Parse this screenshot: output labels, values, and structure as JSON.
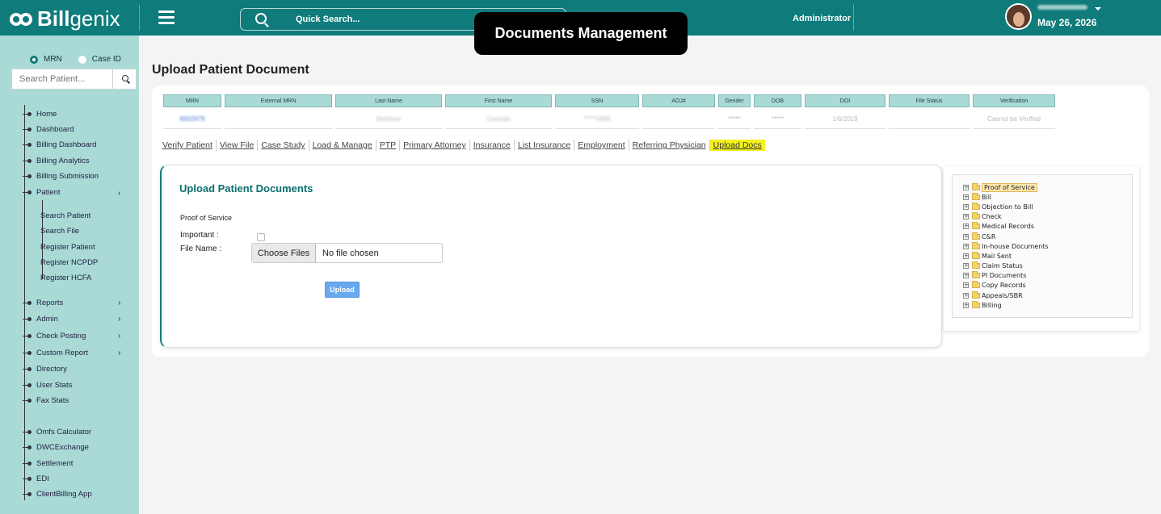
{
  "header": {
    "logo_bold": "Bill",
    "logo_light": "genix",
    "quick_search": "Quick Search...",
    "role": "Administrator",
    "date": "May 26, 2026"
  },
  "banner": "Documents Management",
  "sidebar": {
    "radio_mrn": "MRN",
    "radio_case": "Case ID",
    "search_placeholder": "Search Patient...",
    "items": [
      "Home",
      "Dashboard",
      "Billing Dashboard",
      "Billing Analytics",
      "Billing Submission",
      "Patient"
    ],
    "patient_sub": [
      "Search Patient",
      "Search File",
      "Register Patient",
      "Register NCPDP",
      "Register HCFA"
    ],
    "items2": [
      "Reports",
      "Admin",
      "Check Posting",
      "Custom Report",
      "Directory",
      "User Stats",
      "Fax Stats"
    ],
    "items3": [
      "Omfs Calculator",
      "DWCExchange",
      "Settlement",
      "EDI",
      "ClientBilling App"
    ]
  },
  "page_title": "Upload Patient Document",
  "grid": {
    "headers": [
      "MRN",
      "External MRN",
      "Last Name",
      "First Name",
      "SSN",
      "AOJ#",
      "Gender",
      "DOB",
      "DOI",
      "File Status",
      "Verification"
    ],
    "row": [
      "6002679",
      "",
      "Martinez",
      "Gonzalo",
      "*****5845",
      "",
      "*****",
      "*****",
      "1/6/2019",
      "",
      "Cannot be Verified"
    ]
  },
  "tabs": [
    "Verify Patient",
    "View File",
    "Case Study",
    "Load & Manage",
    "PTP",
    "Primary Attorney",
    "Insurance",
    "List Insurance",
    "Employment",
    "Referring Physician",
    "Upload Docs"
  ],
  "upload": {
    "title": "Upload Patient Documents",
    "section": "Proof of Service",
    "important_label": "Important :",
    "file_label": "File Name :",
    "choose_files": "Choose Files",
    "no_file": "No file chosen",
    "upload_button": "Upload"
  },
  "tree": [
    "Proof of Service",
    "Bill",
    "Objection to Bill",
    "Check",
    "Medical Records",
    "C&R",
    "In-house Documents",
    "Mail Sent",
    "Claim Status",
    "PI Documents",
    "Copy Records",
    "Appeals/SBR",
    "Billing"
  ],
  "colors": {
    "brand": "#0f7b7b",
    "sidebar": "#a9dad6",
    "highlight": "#f4f21a"
  }
}
